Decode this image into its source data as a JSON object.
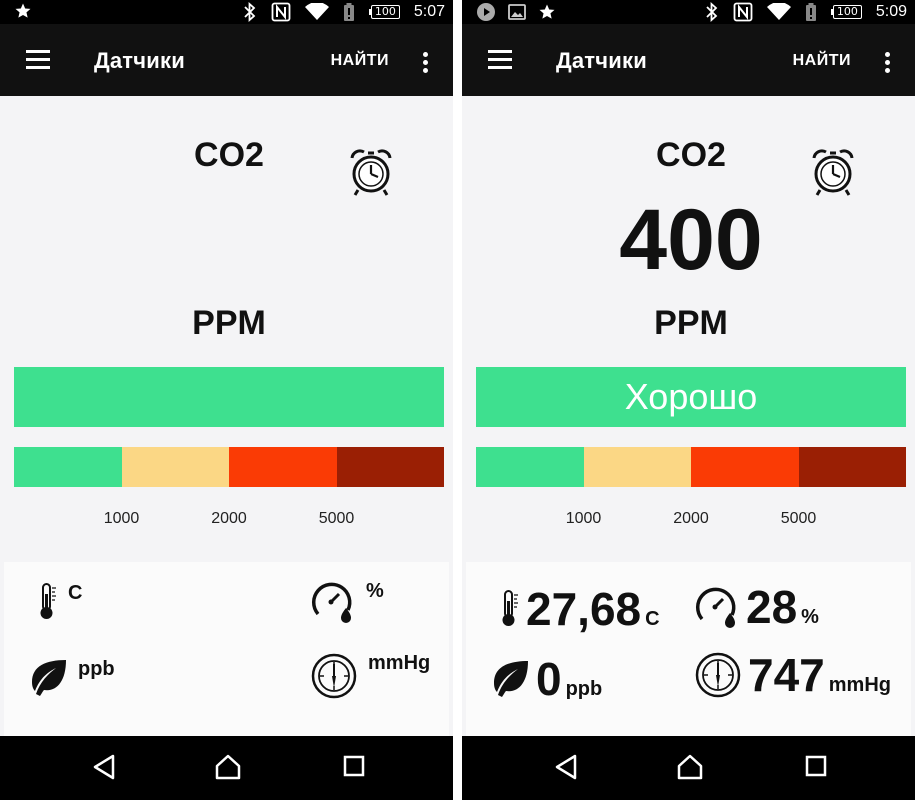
{
  "colors": {
    "good": "#3ee08f",
    "moderate": "#fbd785",
    "bad": "#fa3b05",
    "very_bad": "#9a1f04",
    "toolbar": "#111111"
  },
  "scale_labels": [
    "1000",
    "2000",
    "5000"
  ],
  "screens": [
    {
      "status": {
        "left_icons": [
          "star-icon"
        ],
        "battery": "100",
        "time": "5:07"
      },
      "toolbar": {
        "title": "Датчики",
        "find_label": "НАЙТИ"
      },
      "sensor": {
        "name": "CO2",
        "value": "",
        "unit": "PPM",
        "status_text": ""
      },
      "metrics": {
        "temperature": {
          "value": "",
          "unit": "C",
          "icon": "thermometer-icon"
        },
        "humidity": {
          "value": "",
          "unit": "%",
          "icon": "gauge-drop-icon"
        },
        "tvoc": {
          "value": "",
          "unit": "ppb",
          "icon": "leaf-icon"
        },
        "pressure": {
          "value": "",
          "unit": "mmHg",
          "icon": "barometer-icon"
        }
      }
    },
    {
      "status": {
        "left_icons": [
          "play-icon",
          "image-icon",
          "star-icon"
        ],
        "battery": "100",
        "time": "5:09"
      },
      "toolbar": {
        "title": "Датчики",
        "find_label": "НАЙТИ"
      },
      "sensor": {
        "name": "CO2",
        "value": "400",
        "unit": "PPM",
        "status_text": "Хорошо"
      },
      "metrics": {
        "temperature": {
          "value": "27,68",
          "unit": "C",
          "icon": "thermometer-icon"
        },
        "humidity": {
          "value": "28",
          "unit": "%",
          "icon": "gauge-drop-icon"
        },
        "tvoc": {
          "value": "0",
          "unit": "ppb",
          "icon": "leaf-icon"
        },
        "pressure": {
          "value": "747",
          "unit": "mmHg",
          "icon": "barometer-icon"
        }
      }
    }
  ]
}
